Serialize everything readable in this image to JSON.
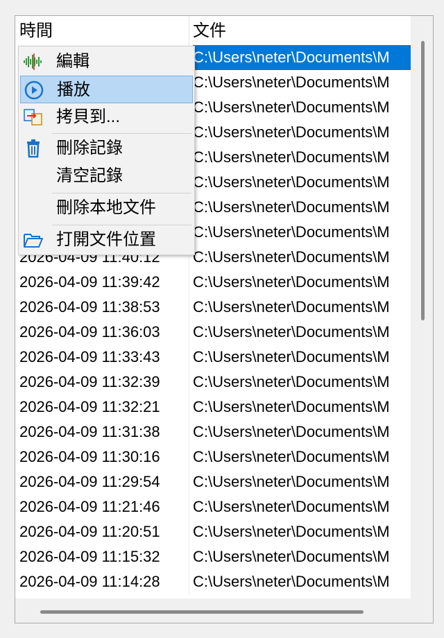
{
  "columns": {
    "time": "時間",
    "file": "文件"
  },
  "rows": [
    {
      "time": "",
      "file": "C:\\Users\\neter\\Documents\\M"
    },
    {
      "time": "",
      "file": "C:\\Users\\neter\\Documents\\M"
    },
    {
      "time": "",
      "file": "C:\\Users\\neter\\Documents\\M"
    },
    {
      "time": "",
      "file": "C:\\Users\\neter\\Documents\\M"
    },
    {
      "time": "",
      "file": "C:\\Users\\neter\\Documents\\M"
    },
    {
      "time": "",
      "file": "C:\\Users\\neter\\Documents\\M"
    },
    {
      "time": "",
      "file": "C:\\Users\\neter\\Documents\\M"
    },
    {
      "time": "",
      "file": "C:\\Users\\neter\\Documents\\M"
    },
    {
      "time": "2026-04-09 11:40:12",
      "file": "C:\\Users\\neter\\Documents\\M"
    },
    {
      "time": "2026-04-09 11:39:42",
      "file": "C:\\Users\\neter\\Documents\\M"
    },
    {
      "time": "2026-04-09 11:38:53",
      "file": "C:\\Users\\neter\\Documents\\M"
    },
    {
      "time": "2026-04-09 11:36:03",
      "file": "C:\\Users\\neter\\Documents\\M"
    },
    {
      "time": "2026-04-09 11:33:43",
      "file": "C:\\Users\\neter\\Documents\\M"
    },
    {
      "time": "2026-04-09 11:32:39",
      "file": "C:\\Users\\neter\\Documents\\M"
    },
    {
      "time": "2026-04-09 11:32:21",
      "file": "C:\\Users\\neter\\Documents\\M"
    },
    {
      "time": "2026-04-09 11:31:38",
      "file": "C:\\Users\\neter\\Documents\\M"
    },
    {
      "time": "2026-04-09 11:30:16",
      "file": "C:\\Users\\neter\\Documents\\M"
    },
    {
      "time": "2026-04-09 11:29:54",
      "file": "C:\\Users\\neter\\Documents\\M"
    },
    {
      "time": "2026-04-09 11:21:46",
      "file": "C:\\Users\\neter\\Documents\\M"
    },
    {
      "time": "2026-04-09 11:20:51",
      "file": "C:\\Users\\neter\\Documents\\M"
    },
    {
      "time": "2026-04-09 11:15:32",
      "file": "C:\\Users\\neter\\Documents\\M"
    },
    {
      "time": "2026-04-09 11:14:28",
      "file": "C:\\Users\\neter\\Documents\\M"
    }
  ],
  "context_menu": {
    "edit": {
      "label": "編輯",
      "icon": "waveform-icon"
    },
    "play": {
      "label": "播放",
      "icon": "play-circle-icon"
    },
    "copy_to": {
      "label": "拷貝到...",
      "icon": "copy-to-icon"
    },
    "delete_record": {
      "label": "刪除記錄",
      "icon": "trash-icon"
    },
    "clear_records": {
      "label": "清空記錄"
    },
    "delete_local_file": {
      "label": "刪除本地文件"
    },
    "open_location": {
      "label": "打開文件位置",
      "icon": "folder-open-icon"
    }
  },
  "colors": {
    "selection": "#0078d7",
    "menu_highlight": "#b8d8f5",
    "icon_blue": "#1a73c9"
  }
}
